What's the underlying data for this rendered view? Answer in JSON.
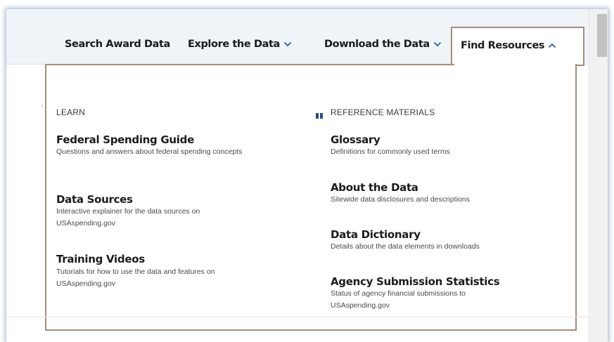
{
  "nav": {
    "items": [
      {
        "label": "Search Award Data"
      },
      {
        "label": "Explore the Data",
        "has_chevron": "down"
      },
      {
        "label": "Download the Data",
        "has_chevron": "down"
      },
      {
        "label": "Find Resources",
        "has_chevron": "up",
        "active": true
      }
    ]
  },
  "dropdown": {
    "learn": {
      "header": "LEARN",
      "links": [
        {
          "title": "Federal Spending Guide",
          "description": "Questions and answers about federal spending concepts"
        },
        {
          "title": "Data Sources",
          "description": "Interactive explainer for the data sources on USAspending.gov"
        },
        {
          "title": "Training Videos",
          "description": "Tutorials for how to use the data and features on USAspending.gov"
        }
      ]
    },
    "reference": {
      "header": "REFERENCE MATERIALS",
      "links": [
        {
          "title": "Glossary",
          "description": "Definitions for commonly used terms"
        },
        {
          "title": "About the Data",
          "description": "Sitewide data disclosures and descriptions"
        },
        {
          "title": "Data Dictionary",
          "description": "Details about the data elements in downloads"
        },
        {
          "title": "Agency Submission Statistics",
          "description": "Status of agency financial submissions to USAspending.gov"
        }
      ]
    }
  },
  "colors": {
    "nav_background": "#eef4f8",
    "highlight_border": "#a68b7a",
    "text_dark": "#1b1b1b",
    "icon_blue": "#1f4e8c"
  },
  "icons": {
    "learn": "book-icon",
    "reference": "book-icon",
    "chevron_down": "chevron-down-icon",
    "chevron_up": "chevron-up-icon"
  }
}
